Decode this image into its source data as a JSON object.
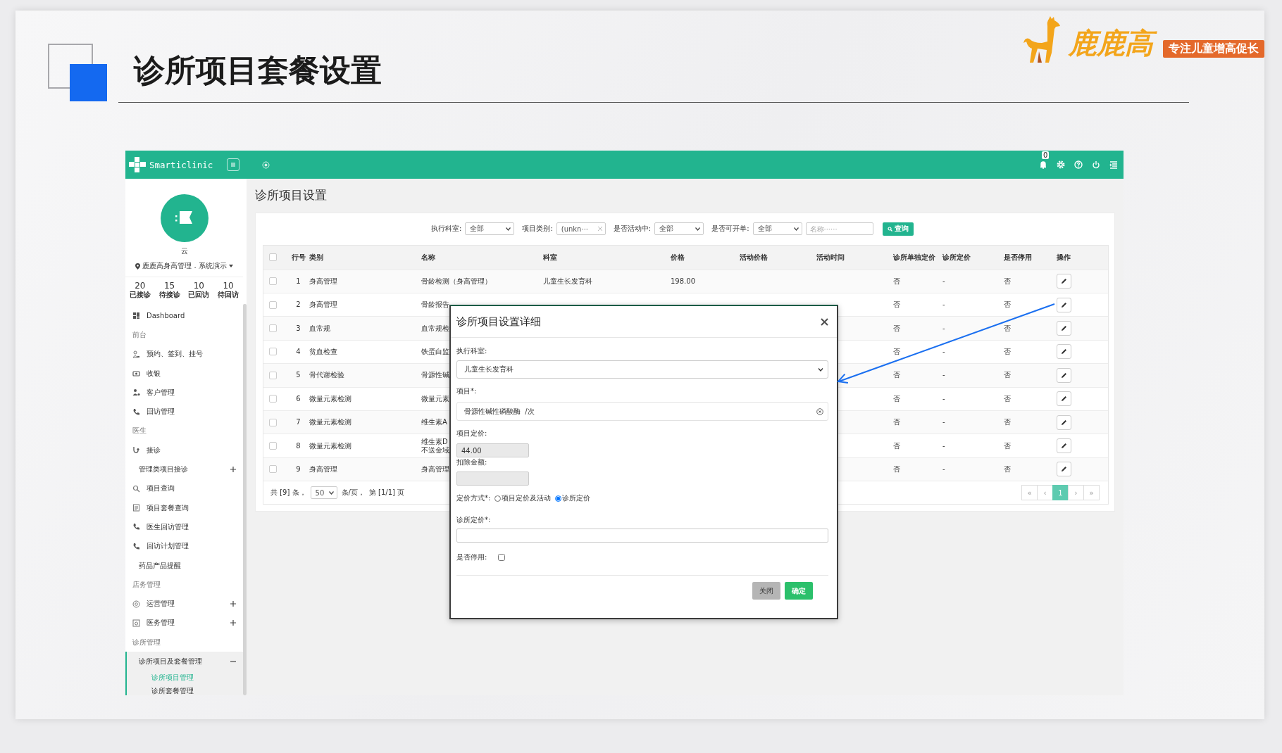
{
  "slide": {
    "title": "诊所项目套餐设置",
    "logo": {
      "name": "鹿鹿高",
      "tagline": "专注儿童增高促长"
    }
  },
  "app": {
    "topbar": {
      "brand": "Smarticlinic",
      "notification_count": "0"
    },
    "sidebar": {
      "user": {
        "name": "云",
        "location": "鹿鹿高身高管理 . 系统演示"
      },
      "stats": [
        {
          "value": "20",
          "label": "已接诊"
        },
        {
          "value": "15",
          "label": "待接诊"
        },
        {
          "value": "10",
          "label": "已回访"
        },
        {
          "value": "10",
          "label": "待回访"
        }
      ],
      "menu": [
        {
          "kind": "link",
          "label": "Dashboard"
        },
        {
          "kind": "section",
          "label": "前台"
        },
        {
          "kind": "link",
          "label": "预约、签到、挂号"
        },
        {
          "kind": "link",
          "label": "收银"
        },
        {
          "kind": "link",
          "label": "客户管理"
        },
        {
          "kind": "link",
          "label": "回访管理"
        },
        {
          "kind": "section",
          "label": "医生"
        },
        {
          "kind": "link",
          "label": "接诊"
        },
        {
          "kind": "group",
          "label": "管理类项目接诊",
          "expanded": false
        },
        {
          "kind": "link",
          "label": "项目查询"
        },
        {
          "kind": "link",
          "label": "项目套餐查询"
        },
        {
          "kind": "link",
          "label": "医生回访管理"
        },
        {
          "kind": "link",
          "label": "回访计划管理"
        },
        {
          "kind": "plain",
          "label": "药品产品提醒"
        },
        {
          "kind": "section",
          "label": "店务管理"
        },
        {
          "kind": "group",
          "label": "运营管理",
          "expanded": false
        },
        {
          "kind": "group",
          "label": "医务管理",
          "expanded": false
        },
        {
          "kind": "section",
          "label": "诊所管理"
        },
        {
          "kind": "group",
          "label": "诊所项目及套餐管理",
          "expanded": true,
          "children": [
            {
              "label": "诊所项目管理",
              "selected": true
            },
            {
              "label": "诊所套餐管理",
              "selected": false
            }
          ]
        }
      ]
    },
    "page": {
      "title": "诊所项目设置",
      "filters": [
        {
          "kind": "select",
          "label": "执行科室:",
          "value": "全部"
        },
        {
          "kind": "tag",
          "label": "项目类别:",
          "value": "(unkn···"
        },
        {
          "kind": "select",
          "label": "是否活动中:",
          "value": "全部"
        },
        {
          "kind": "select",
          "label": "是否可开单:",
          "value": "全部"
        },
        {
          "kind": "input",
          "placeholder": "名称······"
        }
      ],
      "query_button": "查询",
      "table": {
        "all_checked": false,
        "columns": [
          "行号",
          "类别",
          "名称",
          "科室",
          "价格",
          "活动价格",
          "活动时间",
          "诊所单独定价",
          "诊所定价",
          "是否停用",
          "操作"
        ],
        "rows": [
          {
            "checked": false,
            "no": "1",
            "category": "身高管理",
            "name": "骨龄检测（身高管理）",
            "department": "儿童生长发育科",
            "price": "198.00",
            "clinic_own_pricing": "否",
            "clinic_price": "-",
            "disabled": "否"
          },
          {
            "checked": false,
            "no": "2",
            "category": "身高管理",
            "name": "骨龄报告",
            "clinic_own_pricing": "否",
            "clinic_price": "-",
            "disabled": "否"
          },
          {
            "checked": false,
            "no": "3",
            "category": "血常规",
            "name": "血常规检",
            "clinic_own_pricing": "否",
            "clinic_price": "-",
            "disabled": "否"
          },
          {
            "checked": false,
            "no": "4",
            "category": "贫血检查",
            "name": "铁蛋白监",
            "clinic_own_pricing": "否",
            "clinic_price": "-",
            "disabled": "否"
          },
          {
            "checked": false,
            "no": "5",
            "category": "骨代谢检验",
            "name": "骨源性碱",
            "clinic_own_pricing": "否",
            "clinic_price": "-",
            "disabled": "否"
          },
          {
            "checked": false,
            "no": "6",
            "category": "微量元素检测",
            "name": "微量元素",
            "clinic_own_pricing": "否",
            "clinic_price": "-",
            "disabled": "否"
          },
          {
            "checked": false,
            "no": "7",
            "category": "微量元素检测",
            "name": "维生素A",
            "clinic_own_pricing": "否",
            "clinic_price": "-",
            "disabled": "否"
          },
          {
            "checked": false,
            "no": "8",
            "category": "微量元素检测",
            "name": "维生素D\n不送金域",
            "clinic_own_pricing": "否",
            "clinic_price": "-",
            "disabled": "否"
          },
          {
            "checked": false,
            "no": "9",
            "category": "身高管理",
            "name": "身高管理",
            "clinic_own_pricing": "否",
            "clinic_price": "-",
            "disabled": "否"
          }
        ]
      },
      "footer": {
        "total": "共 [9] 条，",
        "page_size": "50",
        "per_page": "条/页，",
        "page_info": "第 [1/1] 页"
      },
      "pagination": [
        {
          "label": "«",
          "selected": false
        },
        {
          "label": "‹",
          "selected": false
        },
        {
          "label": "1",
          "selected": true
        },
        {
          "label": "›",
          "selected": false
        },
        {
          "label": "»",
          "selected": false
        }
      ]
    },
    "dialog": {
      "title": "诊所项目设置详细",
      "department": {
        "label": "执行科室:",
        "value": "儿童生长发育科"
      },
      "item": {
        "label": "项目*:",
        "value": "骨源性碱性磷酸酶  /次"
      },
      "item_price": {
        "label": "项目定价:",
        "value": "44.00"
      },
      "deduction": {
        "label": "扣除金额:"
      },
      "pricing_mode": {
        "label": "定价方式*:",
        "options": [
          {
            "label": "项目定价及活动",
            "selected": false
          },
          {
            "label": "诊所定价",
            "selected": true
          }
        ]
      },
      "clinic_price": {
        "label": "诊所定价*:"
      },
      "disabled": {
        "label": "是否停用:",
        "checked": false
      },
      "buttons": [
        {
          "label": "关闭",
          "kind": "secondary"
        },
        {
          "label": "确定",
          "kind": "primary"
        }
      ]
    }
  }
}
